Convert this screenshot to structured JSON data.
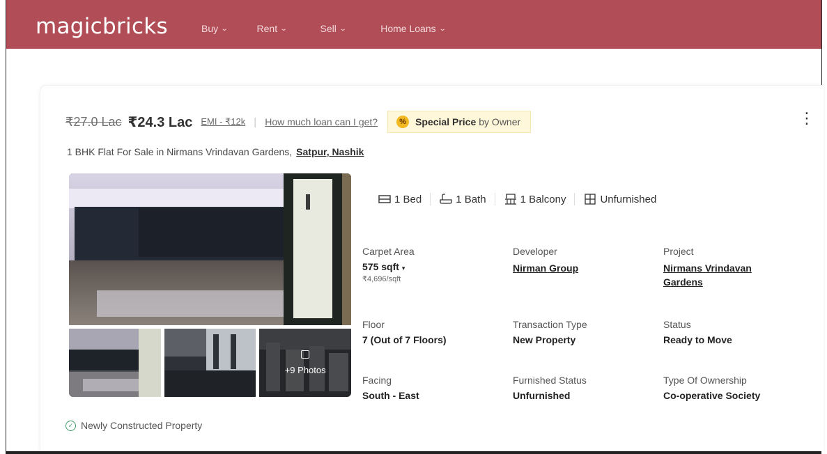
{
  "header": {
    "logo": "magicbricks",
    "nav": [
      {
        "label": "Buy",
        "name": "nav-buy"
      },
      {
        "label": "Rent",
        "name": "nav-rent"
      },
      {
        "label": "Sell",
        "name": "nav-sell"
      },
      {
        "label": "Home Loans",
        "name": "nav-home-loans"
      }
    ],
    "brand_color": "#b14d57"
  },
  "listing": {
    "old_price": "₹27.0 Lac",
    "price": "₹24.3 Lac",
    "emi": "EMI - ₹12k",
    "separator": "|",
    "loan_link": "How much loan can I get?",
    "special_badge": {
      "icon": "%",
      "bold": "Special Price",
      "rest": "by Owner"
    },
    "title": "1 BHK Flat For Sale in Nirmans Vrindavan Gardens,",
    "locality": "Satpur, Nashik",
    "photos_more": "+9 Photos",
    "amenities": [
      {
        "icon": "bed-icon",
        "label": "1 Bed"
      },
      {
        "icon": "bath-icon",
        "label": "1 Bath"
      },
      {
        "icon": "balcony-icon",
        "label": "1 Balcony"
      },
      {
        "icon": "furnishing-icon",
        "label": "Unfurnished"
      }
    ],
    "summary": {
      "carpet_area": {
        "label": "Carpet Area",
        "value": "575 sqft",
        "sub": "₹4,696/sqft"
      },
      "developer": {
        "label": "Developer",
        "value": "Nirman Group"
      },
      "project": {
        "label": "Project",
        "value_line1": "Nirmans Vrindavan",
        "value_line2": "Gardens"
      },
      "floor": {
        "label": "Floor",
        "value": "7 (Out of 7 Floors)"
      },
      "transaction": {
        "label": "Transaction Type",
        "value": "New Property"
      },
      "status": {
        "label": "Status",
        "value": "Ready to Move"
      },
      "facing": {
        "label": "Facing",
        "value": "South - East"
      },
      "furnished": {
        "label": "Furnished Status",
        "value": "Unfurnished"
      },
      "ownership": {
        "label": "Type Of Ownership",
        "value": "Co-operative Society"
      }
    },
    "tag": "Newly Constructed Property"
  }
}
